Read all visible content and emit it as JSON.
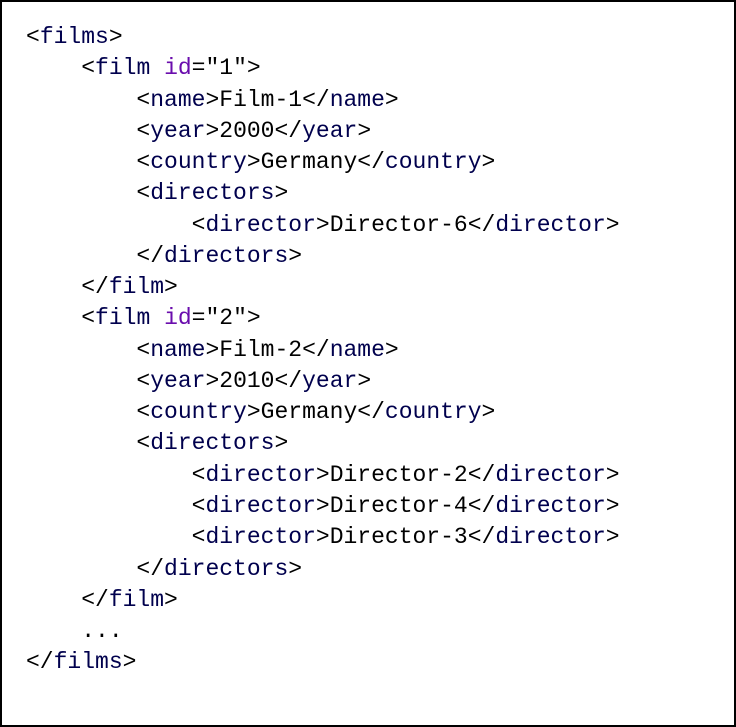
{
  "code": {
    "lines": [
      {
        "indent": 0,
        "tokens": [
          {
            "p": "<"
          },
          {
            "t": "films"
          },
          {
            "p": ">"
          }
        ]
      },
      {
        "indent": 1,
        "tokens": [
          {
            "p": "<"
          },
          {
            "t": "film"
          },
          {
            "sp": " "
          },
          {
            "a": "id"
          },
          {
            "p": "="
          },
          {
            "p": "\""
          },
          {
            "v": "1"
          },
          {
            "p": "\""
          },
          {
            "p": ">"
          }
        ]
      },
      {
        "indent": 2,
        "tokens": [
          {
            "p": "<"
          },
          {
            "t": "name"
          },
          {
            "p": ">"
          },
          {
            "v": "Film-1"
          },
          {
            "p": "</"
          },
          {
            "t": "name"
          },
          {
            "p": ">"
          }
        ]
      },
      {
        "indent": 2,
        "tokens": [
          {
            "p": "<"
          },
          {
            "t": "year"
          },
          {
            "p": ">"
          },
          {
            "v": "2000"
          },
          {
            "p": "</"
          },
          {
            "t": "year"
          },
          {
            "p": ">"
          }
        ]
      },
      {
        "indent": 2,
        "tokens": [
          {
            "p": "<"
          },
          {
            "t": "country"
          },
          {
            "p": ">"
          },
          {
            "v": "Germany"
          },
          {
            "p": "</"
          },
          {
            "t": "country"
          },
          {
            "p": ">"
          }
        ]
      },
      {
        "indent": 2,
        "tokens": [
          {
            "p": "<"
          },
          {
            "t": "directors"
          },
          {
            "p": ">"
          }
        ]
      },
      {
        "indent": 3,
        "tokens": [
          {
            "p": "<"
          },
          {
            "t": "director"
          },
          {
            "p": ">"
          },
          {
            "v": "Director-6"
          },
          {
            "p": "</"
          },
          {
            "t": "director"
          },
          {
            "p": ">"
          }
        ]
      },
      {
        "indent": 2,
        "tokens": [
          {
            "p": "</"
          },
          {
            "t": "directors"
          },
          {
            "p": ">"
          }
        ]
      },
      {
        "indent": 1,
        "tokens": [
          {
            "p": "</"
          },
          {
            "t": "film"
          },
          {
            "p": ">"
          }
        ]
      },
      {
        "indent": 1,
        "tokens": [
          {
            "p": "<"
          },
          {
            "t": "film"
          },
          {
            "sp": " "
          },
          {
            "a": "id"
          },
          {
            "p": "="
          },
          {
            "p": "\""
          },
          {
            "v": "2"
          },
          {
            "p": "\""
          },
          {
            "p": ">"
          }
        ]
      },
      {
        "indent": 2,
        "tokens": [
          {
            "p": "<"
          },
          {
            "t": "name"
          },
          {
            "p": ">"
          },
          {
            "v": "Film-2"
          },
          {
            "p": "</"
          },
          {
            "t": "name"
          },
          {
            "p": ">"
          }
        ]
      },
      {
        "indent": 2,
        "tokens": [
          {
            "p": "<"
          },
          {
            "t": "year"
          },
          {
            "p": ">"
          },
          {
            "v": "2010"
          },
          {
            "p": "</"
          },
          {
            "t": "year"
          },
          {
            "p": ">"
          }
        ]
      },
      {
        "indent": 2,
        "tokens": [
          {
            "p": "<"
          },
          {
            "t": "country"
          },
          {
            "p": ">"
          },
          {
            "v": "Germany"
          },
          {
            "p": "</"
          },
          {
            "t": "country"
          },
          {
            "p": ">"
          }
        ]
      },
      {
        "indent": 2,
        "tokens": [
          {
            "p": "<"
          },
          {
            "t": "directors"
          },
          {
            "p": ">"
          }
        ]
      },
      {
        "indent": 3,
        "tokens": [
          {
            "p": "<"
          },
          {
            "t": "director"
          },
          {
            "p": ">"
          },
          {
            "v": "Director-2"
          },
          {
            "p": "</"
          },
          {
            "t": "director"
          },
          {
            "p": ">"
          }
        ]
      },
      {
        "indent": 3,
        "tokens": [
          {
            "p": "<"
          },
          {
            "t": "director"
          },
          {
            "p": ">"
          },
          {
            "v": "Director-4"
          },
          {
            "p": "</"
          },
          {
            "t": "director"
          },
          {
            "p": ">"
          }
        ]
      },
      {
        "indent": 3,
        "tokens": [
          {
            "p": "<"
          },
          {
            "t": "director"
          },
          {
            "p": ">"
          },
          {
            "v": "Director-3"
          },
          {
            "p": "</"
          },
          {
            "t": "director"
          },
          {
            "p": ">"
          }
        ]
      },
      {
        "indent": 2,
        "tokens": [
          {
            "p": "</"
          },
          {
            "t": "directors"
          },
          {
            "p": ">"
          }
        ]
      },
      {
        "indent": 1,
        "tokens": [
          {
            "p": "</"
          },
          {
            "t": "film"
          },
          {
            "p": ">"
          }
        ]
      },
      {
        "indent": 1,
        "tokens": [
          {
            "v": "..."
          }
        ]
      },
      {
        "indent": 0,
        "tokens": [
          {
            "p": "</"
          },
          {
            "t": "films"
          },
          {
            "p": ">"
          }
        ]
      }
    ],
    "indent_unit": "    "
  }
}
